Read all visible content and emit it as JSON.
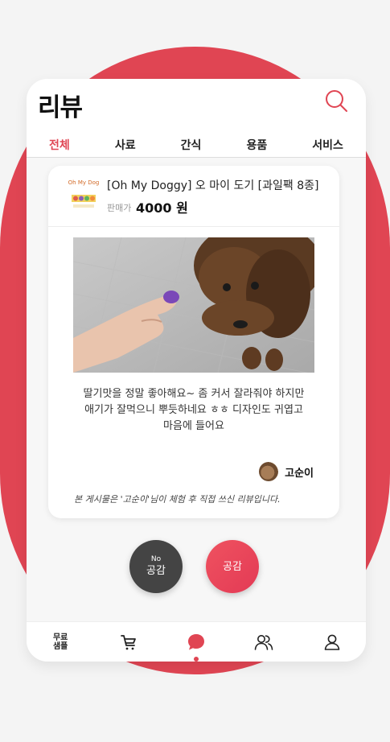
{
  "header": {
    "title": "리뷰"
  },
  "tabs": [
    {
      "label": "전체",
      "active": true
    },
    {
      "label": "사료",
      "active": false
    },
    {
      "label": "간식",
      "active": false
    },
    {
      "label": "용품",
      "active": false
    },
    {
      "label": "서비스",
      "active": false
    }
  ],
  "review": {
    "product_name": "[Oh My Doggy] 오 마이 도기 [과일팩 8종]",
    "price_label": "판매가",
    "price_value": "4000 원",
    "text": "딸기맛을 정말 좋아해요~ 좀 커서 잘라줘야 하지만\n애기가 잘먹으니 뿌듯하네요 ㅎㅎ 디자인도 귀엽고\n마음에 들어요",
    "author": "고순이",
    "notice": "본 게시물은 '고순이'님이 체험 후 직접 쓰신 리뷰입니다."
  },
  "votes": {
    "no_small": "No",
    "no_main": "공감",
    "yes_main": "공감"
  },
  "bottom_nav": {
    "free_sample": "무료\n샘플",
    "active_index": 2
  },
  "colors": {
    "accent": "#e04553",
    "dark_button": "#444444"
  }
}
